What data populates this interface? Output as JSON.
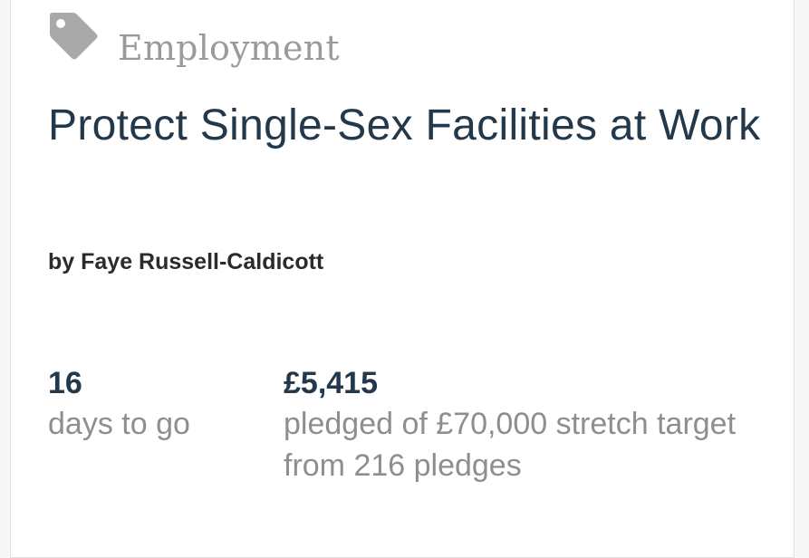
{
  "category": {
    "icon": "tag-icon",
    "label": "Employment"
  },
  "project": {
    "title": "Protect Single-Sex Facilities at Work",
    "author": "by Faye Russell-Caldicott"
  },
  "stats": {
    "days_value": "16",
    "days_label": "days to go",
    "pledged_value": "£5,415",
    "pledged_label": "pledged of £70,000 stretch target from 216 pledges"
  },
  "colors": {
    "title": "#23384a",
    "muted": "#8e8e8e",
    "tag_icon": "#a9a9a9"
  }
}
